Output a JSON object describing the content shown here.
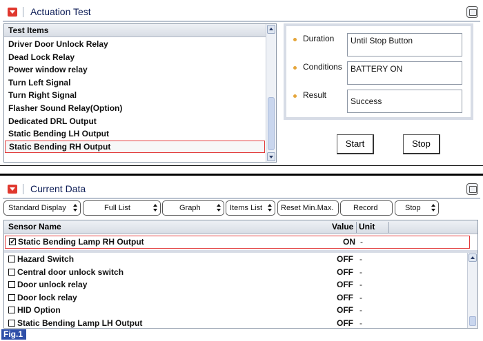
{
  "actuation": {
    "title": "Actuation Test",
    "list_header": "Test Items",
    "items": [
      "Driver Door Unlock Relay",
      "Dead Lock Relay",
      "Power window relay",
      "Turn Left Signal",
      "Turn Right Signal",
      "Flasher Sound Relay(Option)",
      "Dedicated DRL Output",
      "Static Bending LH Output",
      "Static Bending RH Output"
    ],
    "selected_index": 8,
    "duration_label": "Duration",
    "duration_value": "Until Stop Button",
    "conditions_label": "Conditions",
    "conditions_value": "BATTERY ON",
    "result_label": "Result",
    "result_value": "Success",
    "start_label": "Start",
    "stop_label": "Stop"
  },
  "current": {
    "title": "Current Data",
    "toolbar": {
      "standard_display": "Standard Display",
      "full_list": "Full List",
      "graph": "Graph",
      "items_list": "Items List",
      "reset": "Reset Min.Max.",
      "record": "Record",
      "stop": "Stop"
    },
    "columns": {
      "name": "Sensor Name",
      "value": "Value",
      "unit": "Unit"
    },
    "pinned": {
      "name": "Static Bending Lamp RH Output",
      "value": "ON",
      "unit": "-",
      "checked": true
    },
    "rows": [
      {
        "name": "Hazard Switch",
        "value": "OFF",
        "unit": "-",
        "checked": false
      },
      {
        "name": "Central door unlock switch",
        "value": "OFF",
        "unit": "-",
        "checked": false
      },
      {
        "name": "Door unlock relay",
        "value": "OFF",
        "unit": "-",
        "checked": false
      },
      {
        "name": "Door lock relay",
        "value": "OFF",
        "unit": "-",
        "checked": false
      },
      {
        "name": "HID Option",
        "value": "OFF",
        "unit": "-",
        "checked": false
      },
      {
        "name": "Static Bending Lamp LH Output",
        "value": "OFF",
        "unit": "-",
        "checked": false
      }
    ]
  },
  "figure_label": "Fig.1",
  "colors": {
    "accent_red": "#e23a3a",
    "title_blue": "#0b1b55",
    "fig_blue": "#2f4fa8"
  }
}
